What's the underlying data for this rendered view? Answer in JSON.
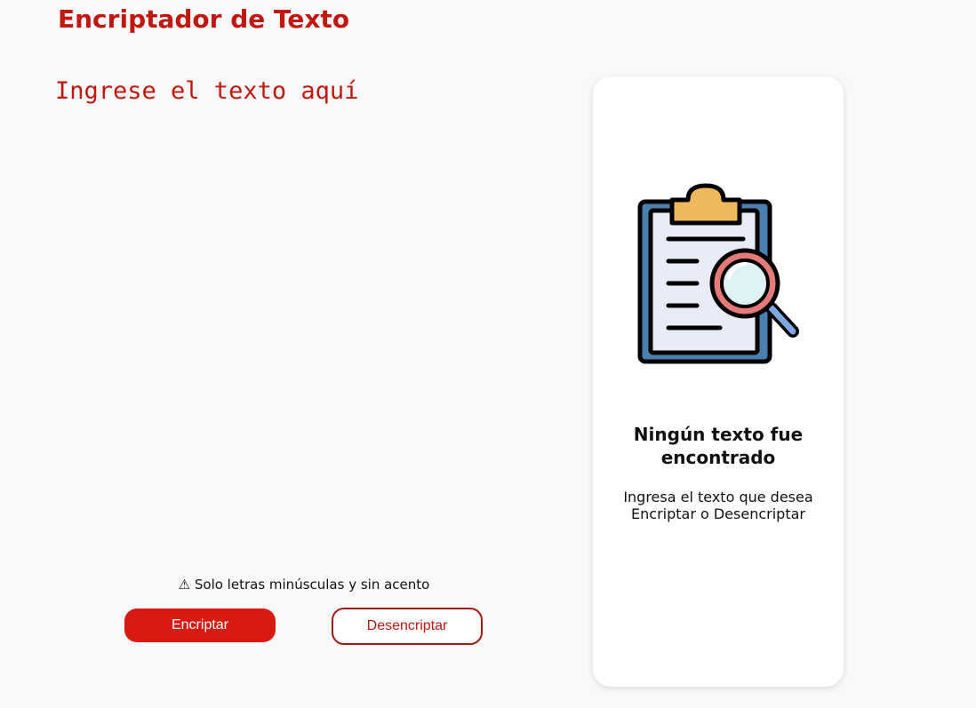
{
  "header": {
    "title": "Encriptador de Texto"
  },
  "input": {
    "placeholder": "Ingrese el texto aquí",
    "value": ""
  },
  "warning": {
    "icon": "warning-icon",
    "text": "⚠ Solo letras minúsculas y sin acento"
  },
  "actions": {
    "encrypt_label": "Encriptar",
    "decrypt_label": "Desencriptar"
  },
  "output_panel": {
    "illustration": "clipboard-search-icon",
    "title": "Ningún texto fue encontrado",
    "message_line1": "Ingresa el texto que desea",
    "message_line2": "Encriptar o Desencriptar"
  },
  "colors": {
    "accent": "#c0180f",
    "button_primary": "#d81b12",
    "background": "#f9f9f9",
    "panel": "#ffffff"
  }
}
